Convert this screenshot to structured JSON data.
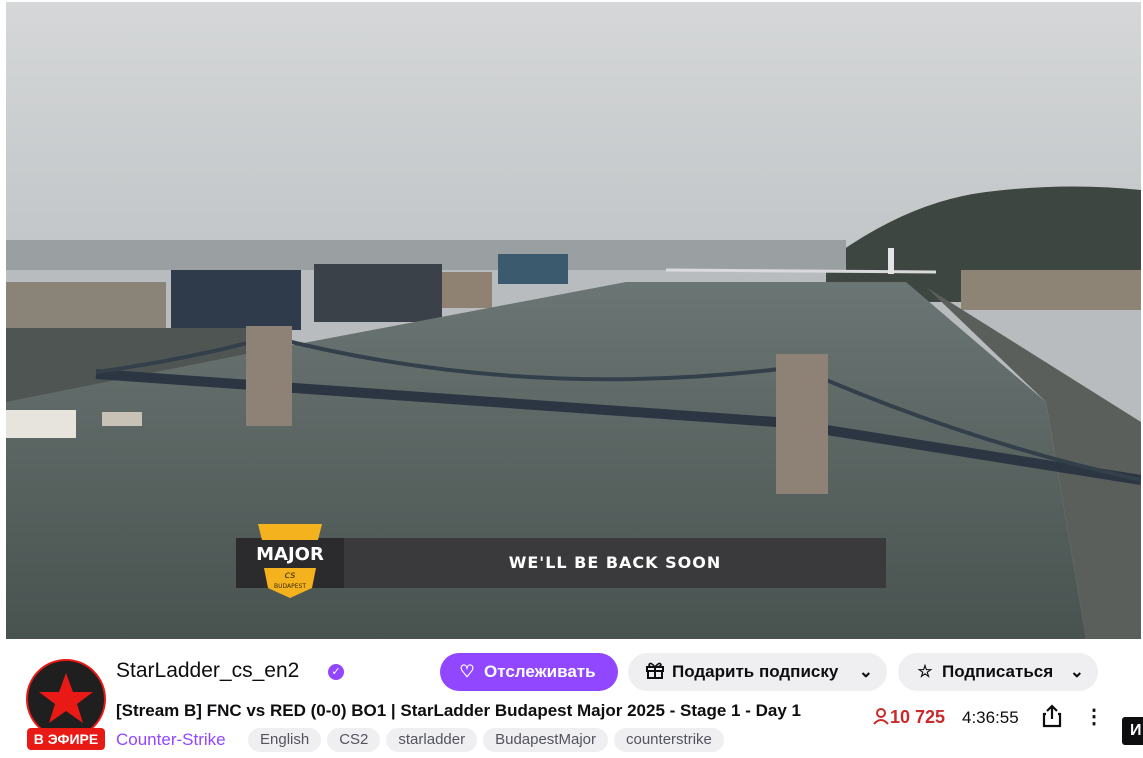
{
  "video": {
    "overlay_text": "WE'LL BE BACK SOON",
    "logo_text": "MAJOR",
    "logo_subtext": "cs",
    "logo_city": "BUDAPEST"
  },
  "channel": {
    "name": "StarLadder_cs_en2",
    "live_badge": "В ЭФИРЕ",
    "verified_icon": "verified-icon",
    "stream_title": "[Stream B] FNC vs RED (0-0) BO1 | StarLadder Budapest Major 2025 - Stage 1 - Day 1",
    "category": "Counter-Strike",
    "tags": [
      "English",
      "CS2",
      "starladder",
      "BudapestMajor",
      "counterstrike"
    ]
  },
  "actions": {
    "follow_label": "Отслеживать",
    "gift_label": "Подарить подписку",
    "subscribe_label": "Подписаться"
  },
  "stats": {
    "viewers": "10 725",
    "uptime": "4:36:55"
  },
  "side_tab_label": "И",
  "colors": {
    "accent": "#9147ff",
    "live": "#e91916",
    "viewers": "#c92a2a"
  }
}
